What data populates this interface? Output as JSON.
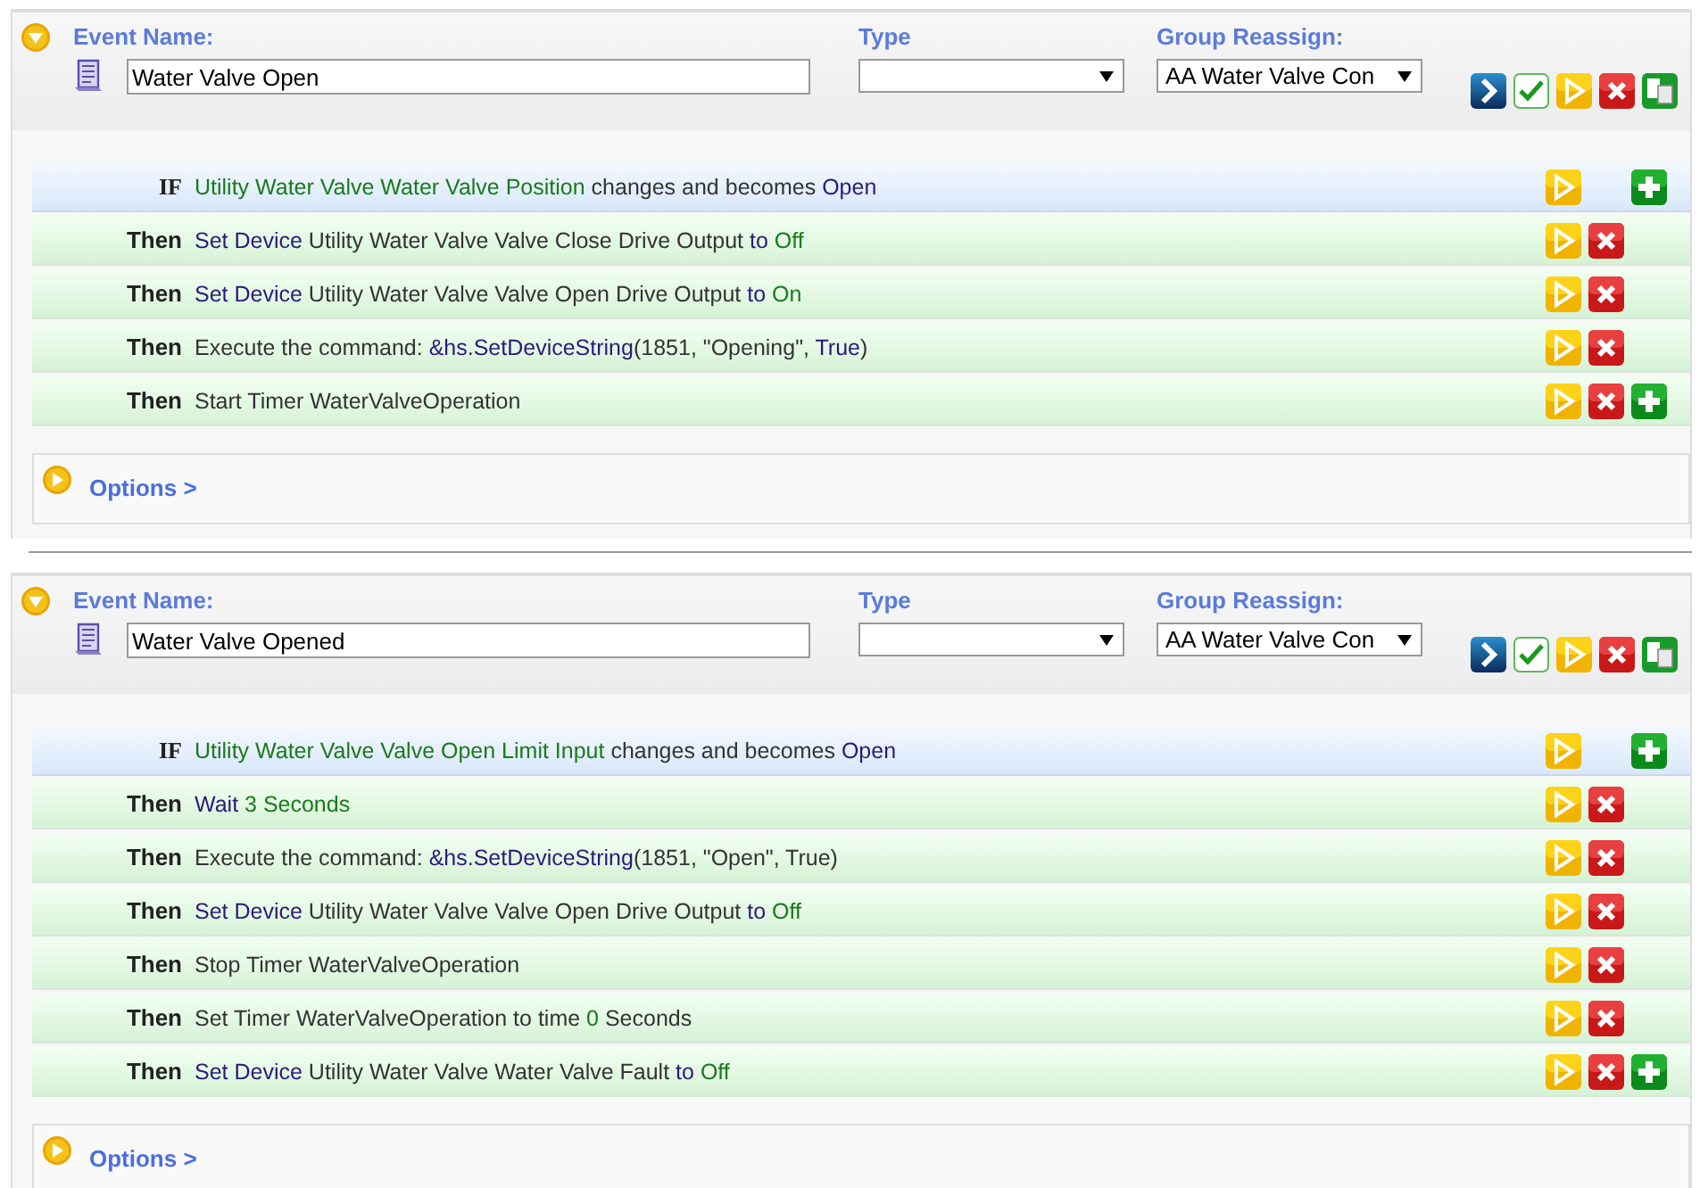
{
  "events": [
    {
      "expanded": true,
      "name_label": "Event Name:",
      "name": "Water Valve Open",
      "type_label": "Type",
      "group_label": "Group Reassign:",
      "group_value": "AA Water Valve Con",
      "rows": [
        {
          "keyword": "IF",
          "kind": "trigger",
          "segments": [
            {
              "kind": "value",
              "text": "Utility Water Valve Water Valve Position"
            },
            {
              "kind": "plain",
              "text": " changes and becomes "
            },
            {
              "kind": "keyword",
              "text": "Open"
            }
          ],
          "actions": [
            {
              "kind": "run"
            },
            {
              "kind": "add"
            }
          ]
        },
        {
          "keyword": "Then",
          "kind": "action",
          "segments": [
            {
              "kind": "keyword",
              "text": "Set Device"
            },
            {
              "kind": "plain",
              "text": " Utility Water Valve Valve Close Drive Output "
            },
            {
              "kind": "keyword",
              "text": "to"
            },
            {
              "kind": "value",
              "text": " Off"
            }
          ],
          "actions": [
            {
              "kind": "run"
            },
            {
              "kind": "delete"
            }
          ]
        },
        {
          "keyword": "Then",
          "kind": "action",
          "segments": [
            {
              "kind": "keyword",
              "text": "Set Device"
            },
            {
              "kind": "plain",
              "text": " Utility Water Valve Valve Open Drive Output "
            },
            {
              "kind": "keyword",
              "text": "to"
            },
            {
              "kind": "value",
              "text": " On"
            }
          ],
          "actions": [
            {
              "kind": "run"
            },
            {
              "kind": "delete"
            }
          ]
        },
        {
          "keyword": "Then",
          "kind": "action",
          "segments": [
            {
              "kind": "plain",
              "text": "Execute the command: "
            },
            {
              "kind": "keyword",
              "text": "&hs.SetDeviceString"
            },
            {
              "kind": "plain",
              "text": "(1851, \"Opening\", "
            },
            {
              "kind": "keyword",
              "text": "True"
            },
            {
              "kind": "plain",
              "text": ")"
            }
          ],
          "actions": [
            {
              "kind": "run"
            },
            {
              "kind": "delete"
            }
          ]
        },
        {
          "keyword": "Then",
          "kind": "action",
          "segments": [
            {
              "kind": "plain",
              "text": "Start Timer WaterValveOperation"
            }
          ],
          "actions": [
            {
              "kind": "run"
            },
            {
              "kind": "delete"
            },
            {
              "kind": "add"
            }
          ]
        }
      ],
      "options_label": "Options >"
    },
    {
      "expanded": true,
      "name_label": "Event Name:",
      "name": "Water Valve Opened",
      "type_label": "Type",
      "group_label": "Group Reassign:",
      "group_value": "AA Water Valve Con",
      "rows": [
        {
          "keyword": "IF",
          "kind": "trigger",
          "segments": [
            {
              "kind": "value",
              "text": "Utility Water Valve Valve Open Limit Input"
            },
            {
              "kind": "plain",
              "text": " changes and becomes "
            },
            {
              "kind": "keyword",
              "text": "Open"
            }
          ],
          "actions": [
            {
              "kind": "run"
            },
            {
              "kind": "add"
            }
          ]
        },
        {
          "keyword": "Then",
          "kind": "action",
          "segments": [
            {
              "kind": "keyword",
              "text": "Wait"
            },
            {
              "kind": "value",
              "text": " 3 Seconds"
            }
          ],
          "actions": [
            {
              "kind": "run"
            },
            {
              "kind": "delete"
            }
          ]
        },
        {
          "keyword": "Then",
          "kind": "action",
          "segments": [
            {
              "kind": "plain",
              "text": "Execute the command: "
            },
            {
              "kind": "keyword",
              "text": "&hs.SetDeviceString"
            },
            {
              "kind": "plain",
              "text": "(1851, \"Open\", True)"
            }
          ],
          "actions": [
            {
              "kind": "run"
            },
            {
              "kind": "delete"
            }
          ]
        },
        {
          "keyword": "Then",
          "kind": "action",
          "segments": [
            {
              "kind": "keyword",
              "text": "Set Device"
            },
            {
              "kind": "plain",
              "text": " Utility Water Valve Valve Open Drive Output "
            },
            {
              "kind": "keyword",
              "text": "to"
            },
            {
              "kind": "value",
              "text": " Off"
            }
          ],
          "actions": [
            {
              "kind": "run"
            },
            {
              "kind": "delete"
            }
          ]
        },
        {
          "keyword": "Then",
          "kind": "action",
          "segments": [
            {
              "kind": "plain",
              "text": "Stop Timer WaterValveOperation"
            }
          ],
          "actions": [
            {
              "kind": "run"
            },
            {
              "kind": "delete"
            }
          ]
        },
        {
          "keyword": "Then",
          "kind": "action",
          "segments": [
            {
              "kind": "plain",
              "text": "Set Timer WaterValveOperation to time "
            },
            {
              "kind": "value",
              "text": "0"
            },
            {
              "kind": "plain",
              "text": " Seconds"
            }
          ],
          "actions": [
            {
              "kind": "run"
            },
            {
              "kind": "delete"
            }
          ]
        },
        {
          "keyword": "Then",
          "kind": "action",
          "segments": [
            {
              "kind": "keyword",
              "text": "Set Device"
            },
            {
              "kind": "plain",
              "text": " Utility Water Valve Water Valve Fault "
            },
            {
              "kind": "keyword",
              "text": "to"
            },
            {
              "kind": "value",
              "text": " Off"
            }
          ],
          "actions": [
            {
              "kind": "run"
            },
            {
              "kind": "delete"
            },
            {
              "kind": "add"
            }
          ]
        }
      ],
      "options_label": "Options >"
    }
  ]
}
